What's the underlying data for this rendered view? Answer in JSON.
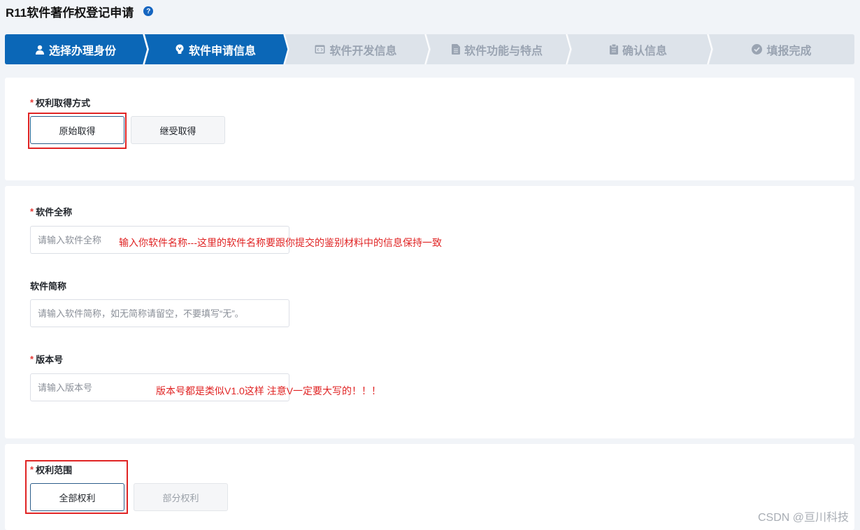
{
  "page": {
    "title": "R11软件著作权登记申请",
    "help_icon_glyph": "?"
  },
  "steps": [
    {
      "label": "选择办理身份",
      "icon": "user-icon",
      "state": "done"
    },
    {
      "label": "软件申请信息",
      "icon": "lightbulb-icon",
      "state": "active"
    },
    {
      "label": "软件开发信息",
      "icon": "code-window-icon",
      "state": "pending"
    },
    {
      "label": "软件功能与特点",
      "icon": "document-icon",
      "state": "pending"
    },
    {
      "label": "确认信息",
      "icon": "clipboard-icon",
      "state": "pending"
    },
    {
      "label": "填报完成",
      "icon": "check-circle-icon",
      "state": "pending"
    }
  ],
  "rights_acquisition": {
    "label": "权利取得方式",
    "options": [
      "原始取得",
      "继受取得"
    ],
    "selected": "原始取得"
  },
  "software_info": {
    "full_name_label": "软件全称",
    "full_name_placeholder": "请输入软件全称",
    "full_name_value": "",
    "full_name_note": "输入你软件名称---这里的软件名称要跟你提交的鉴别材料中的信息保持一致",
    "short_name_label": "软件简称",
    "short_name_placeholder": "请输入软件简称，如无简称请留空，不要填写“无”。",
    "short_name_value": "",
    "version_label": "版本号",
    "version_placeholder": "请输入版本号",
    "version_value": "",
    "version_note": "版本号都是类似V1.0这样  注意V一定要大写的！！！"
  },
  "rights_scope": {
    "label": "权利范围",
    "options": [
      "全部权利",
      "部分权利"
    ],
    "selected": "全部权利"
  },
  "watermark": "CSDN @亘川科技",
  "colors": {
    "step_active": "#0b67b7",
    "step_inactive": "#dde3ea",
    "required_star": "#e53935",
    "annotation_red": "#e02424"
  }
}
